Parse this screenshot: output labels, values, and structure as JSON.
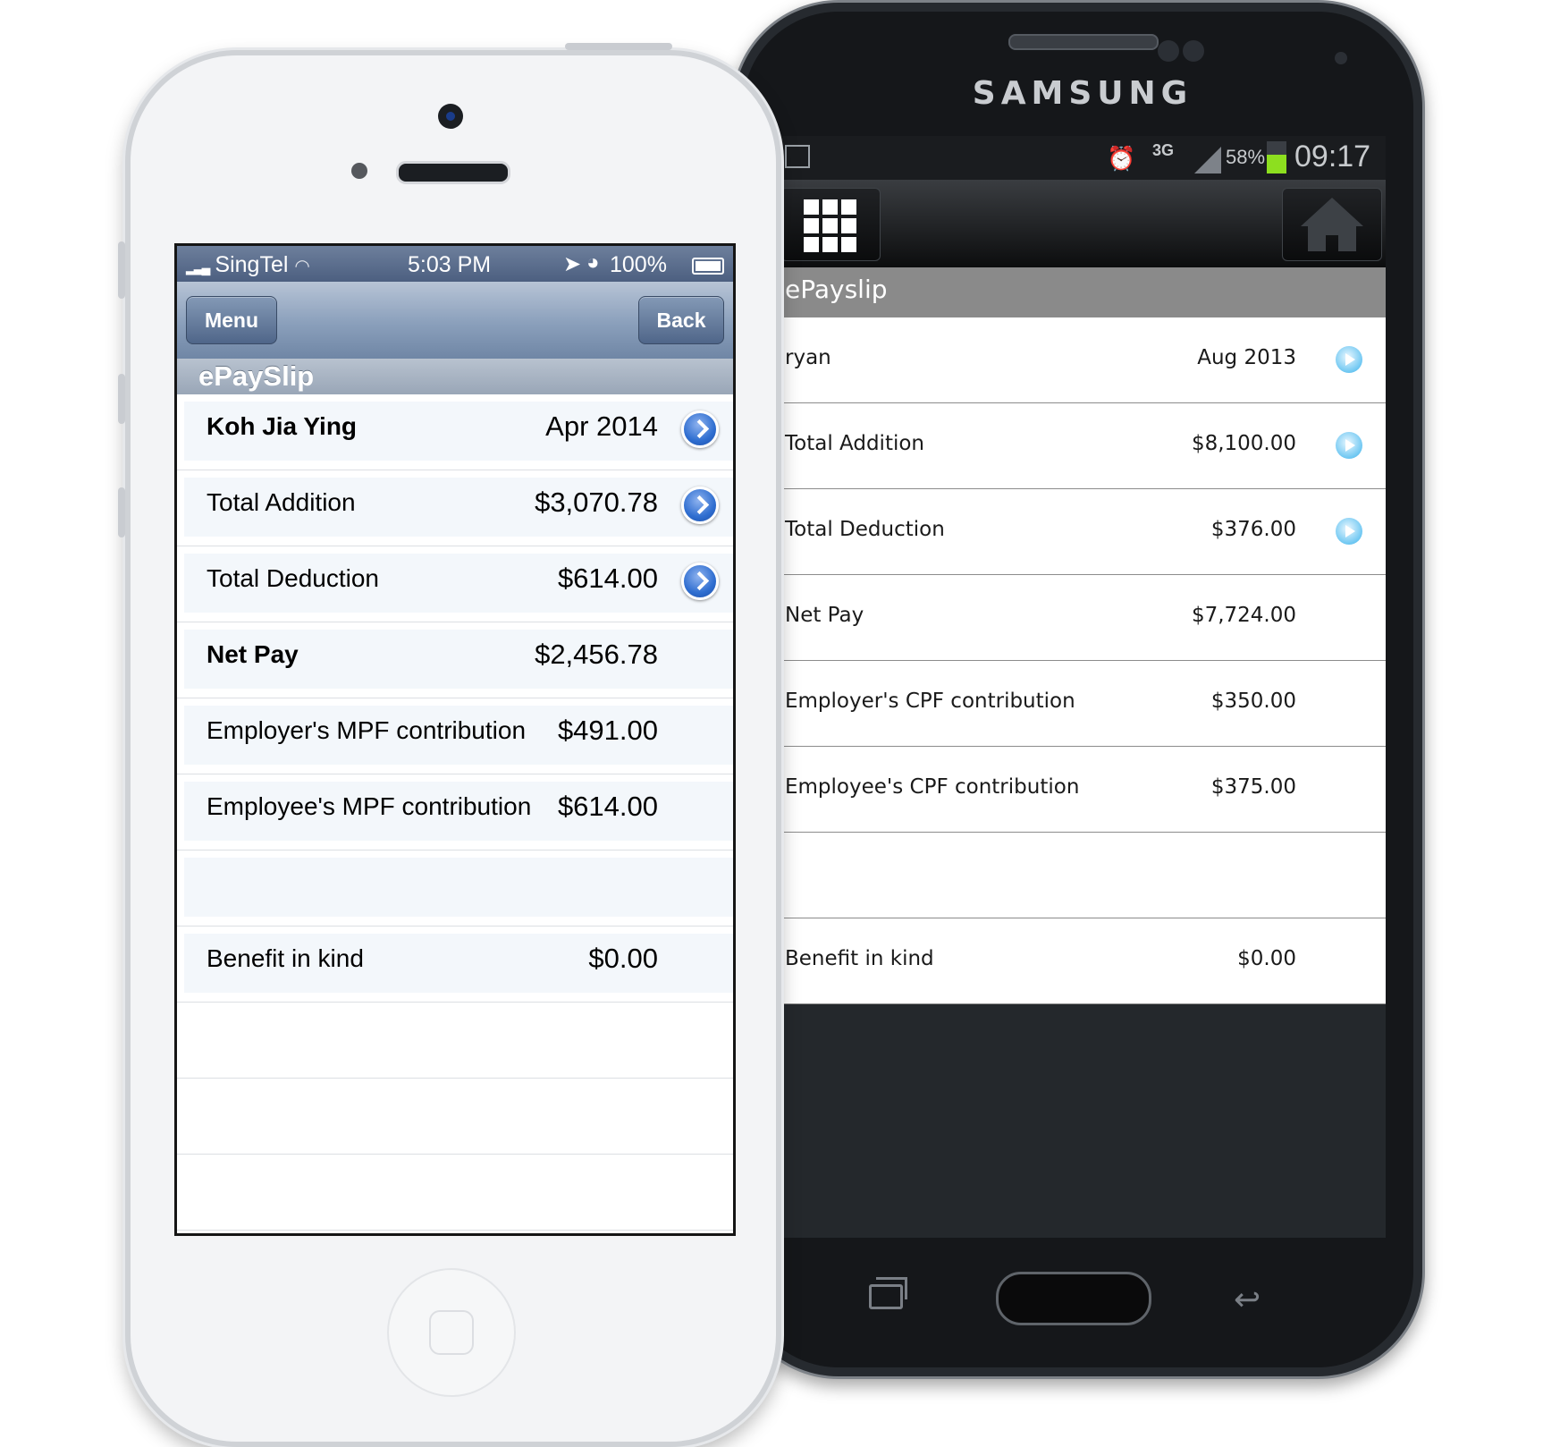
{
  "samsung": {
    "brand": "SAMSUNG",
    "status": {
      "network": "3G",
      "battery": "58%",
      "battery_level": 0.58,
      "time": "09:17"
    },
    "title": "ePayslip",
    "rows": [
      {
        "label": "ryan",
        "value": "Aug 2013",
        "arrow": true
      },
      {
        "label": "Total Addition",
        "value": "$8,100.00",
        "arrow": true
      },
      {
        "label": "Total Deduction",
        "value": "$376.00",
        "arrow": true
      },
      {
        "label": "Net Pay",
        "value": "$7,724.00",
        "arrow": false
      },
      {
        "label": "Employer's CPF contribution",
        "value": "$350.00",
        "arrow": false
      },
      {
        "label": "Employee's CPF contribution",
        "value": "$375.00",
        "arrow": false
      },
      {
        "label": "",
        "value": "",
        "arrow": false
      },
      {
        "label": "Benefit in kind",
        "value": "$0.00",
        "arrow": false
      }
    ]
  },
  "iphone": {
    "status": {
      "carrier": "SingTel",
      "time": "5:03 PM",
      "battery": "100%"
    },
    "nav": {
      "menu_label": "Menu",
      "back_label": "Back"
    },
    "title": "ePaySlip",
    "rows": [
      {
        "label": "Koh Jia Ying",
        "value": "Apr 2014",
        "bold": true,
        "arrow": true
      },
      {
        "label": "Total Addition",
        "value": "$3,070.78",
        "bold": false,
        "arrow": true
      },
      {
        "label": "Total Deduction",
        "value": "$614.00",
        "bold": false,
        "arrow": true
      },
      {
        "label": "Net Pay",
        "value": "$2,456.78",
        "bold": true,
        "arrow": false
      },
      {
        "label": "Employer's MPF contribution",
        "value": "$491.00",
        "bold": false,
        "arrow": false
      },
      {
        "label": "Employee's MPF contribution",
        "value": "$614.00",
        "bold": false,
        "arrow": false
      },
      {
        "label": "",
        "value": "",
        "bold": false,
        "arrow": false
      },
      {
        "label": "Benefit in kind",
        "value": "$0.00",
        "bold": false,
        "arrow": false
      }
    ]
  }
}
